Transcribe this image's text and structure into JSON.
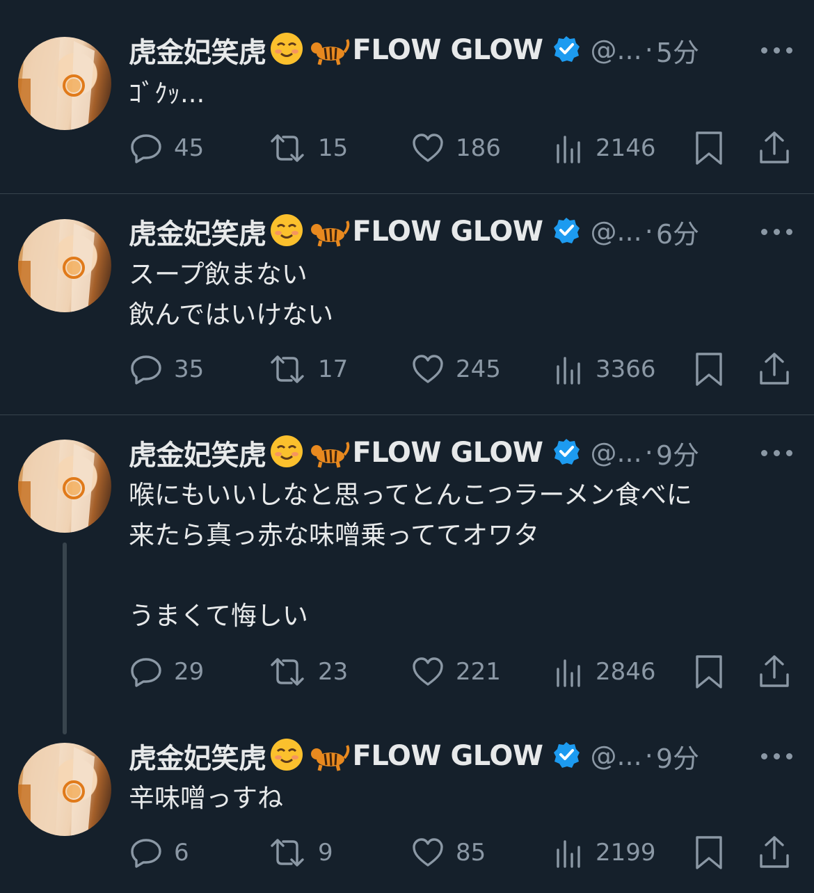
{
  "colors": {
    "background": "#15202b",
    "text": "#e7e9ea",
    "muted": "#8b98a5",
    "divider": "#38444d",
    "verified": "#1d9bf0"
  },
  "tweets": [
    {
      "author_name": "虎金妃笑虎",
      "author_suffix": "FLOW GLOW",
      "emojis": [
        "smiling-face-emoji",
        "tiger-emoji"
      ],
      "handle": "@...",
      "separator": "·",
      "time": "5分",
      "text": "ｺﾞｸｯ...",
      "replies": "45",
      "retweets": "15",
      "likes": "186",
      "views": "2146"
    },
    {
      "author_name": "虎金妃笑虎",
      "author_suffix": "FLOW GLOW",
      "emojis": [
        "smiling-face-emoji",
        "tiger-emoji"
      ],
      "handle": "@...",
      "separator": "·",
      "time": "6分",
      "text": "スープ飲まない\n飲んではいけない",
      "replies": "35",
      "retweets": "17",
      "likes": "245",
      "views": "3366"
    },
    {
      "author_name": "虎金妃笑虎",
      "author_suffix": "FLOW GLOW",
      "emojis": [
        "smiling-face-emoji",
        "tiger-emoji"
      ],
      "handle": "@...",
      "separator": "·",
      "time": "9分",
      "text": "喉にもいいしなと思ってとんこつラーメン食べに\n来たら真っ赤な味噌乗っててオワタ\n\nうまくて悔しい",
      "replies": "29",
      "retweets": "23",
      "likes": "221",
      "views": "2846"
    },
    {
      "author_name": "虎金妃笑虎",
      "author_suffix": "FLOW GLOW",
      "emojis": [
        "smiling-face-emoji",
        "tiger-emoji"
      ],
      "handle": "@...",
      "separator": "·",
      "time": "9分",
      "text": "辛味噌っすね",
      "replies": "6",
      "retweets": "9",
      "likes": "85",
      "views": "2199"
    }
  ]
}
